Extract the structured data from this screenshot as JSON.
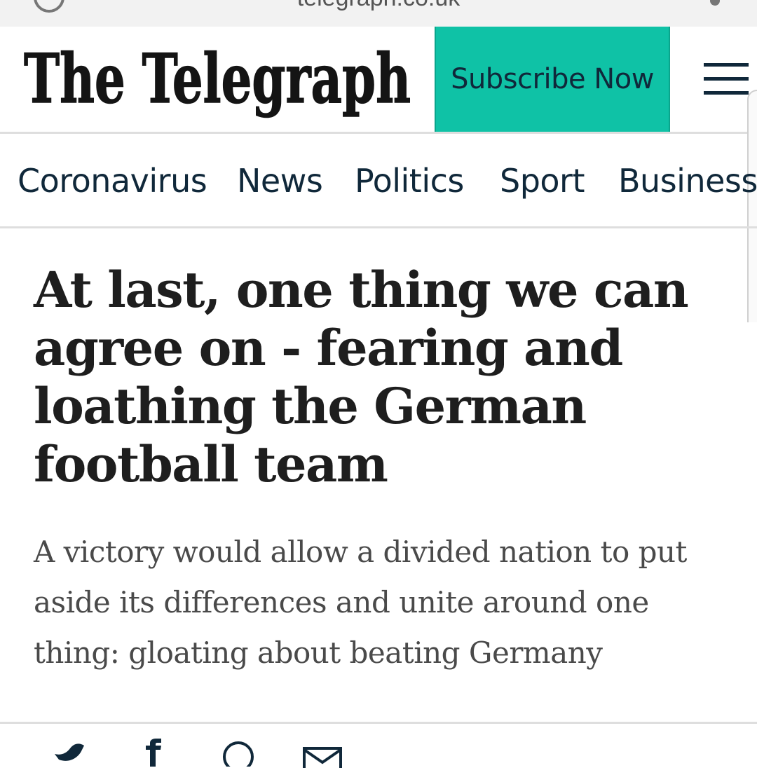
{
  "browser": {
    "url": "telegraph.co.uk"
  },
  "header": {
    "logo_text": "The Telegraph",
    "subscribe_label": "Subscribe Now",
    "menu_icon": "hamburger-menu-icon",
    "accent_color": "#0fc2a6",
    "text_color": "#10283a"
  },
  "nav": {
    "items": [
      {
        "label": "Coronavirus"
      },
      {
        "label": "News"
      },
      {
        "label": "Politics"
      },
      {
        "label": "Sport"
      },
      {
        "label": "Business"
      }
    ]
  },
  "article": {
    "headline": "At last, one thing we can agree on - fearing and loathing the German football team",
    "standfirst": "A victory would allow a divided nation to put aside its differences and unite around one thing: gloating about beating Germany"
  },
  "share": {
    "icons": [
      "twitter-icon",
      "facebook-icon",
      "whatsapp-icon",
      "email-icon"
    ]
  }
}
